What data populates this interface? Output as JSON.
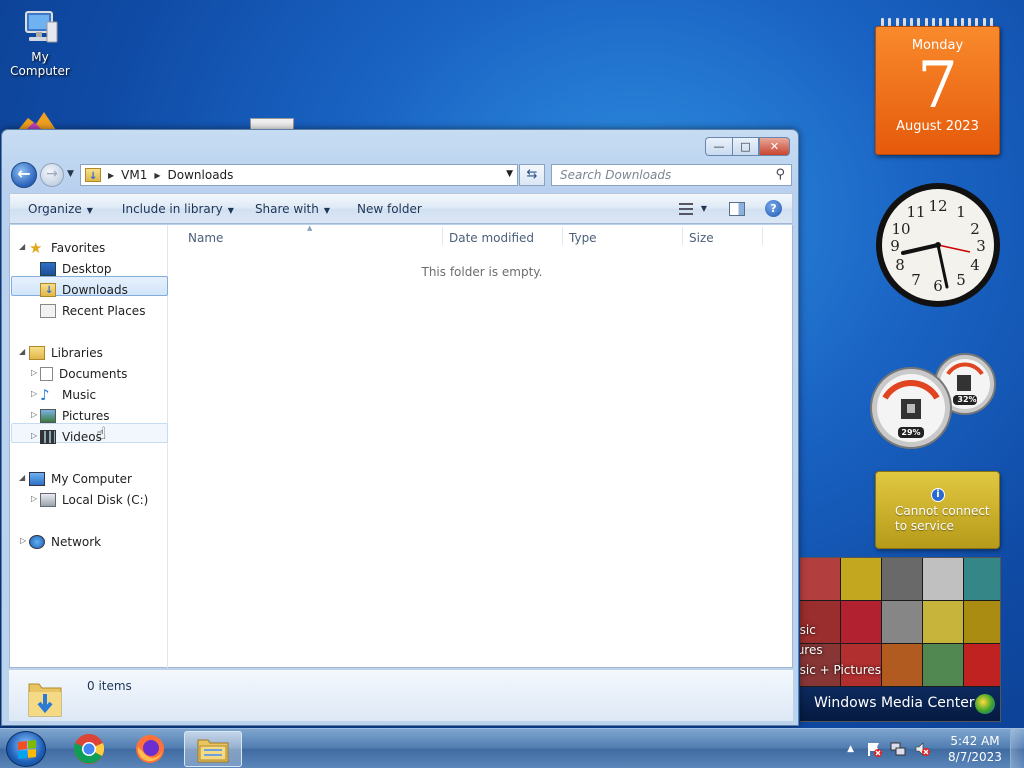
{
  "desktop": {
    "icons": [
      {
        "label": "My Computer"
      }
    ]
  },
  "gadgets": {
    "calendar": {
      "weekday": "Monday",
      "day": "7",
      "month_year": "August 2023"
    },
    "meter": {
      "cpu_percent": "29%",
      "memory_percent": "32%"
    },
    "weather": {
      "message_line1": "Cannot connect",
      "message_line2": "to service"
    },
    "media_center": {
      "menu_items": [
        "usic",
        "tures",
        "usic + Pictures"
      ],
      "title": "Windows Media Center"
    }
  },
  "window": {
    "controls": {
      "minimize": "—",
      "maximize": "□",
      "close": "✕"
    },
    "breadcrumb": [
      "VM1",
      "Downloads"
    ],
    "search_placeholder": "Search Downloads",
    "toolbar": {
      "organize": "Organize",
      "include_in_library": "Include in library",
      "share_with": "Share with",
      "new_folder": "New folder"
    },
    "nav": {
      "favorites": "Favorites",
      "desktop": "Desktop",
      "downloads": "Downloads",
      "recent_places": "Recent Places",
      "libraries": "Libraries",
      "documents": "Documents",
      "music": "Music",
      "pictures": "Pictures",
      "videos": "Videos",
      "my_computer": "My Computer",
      "local_disk": "Local Disk (C:)",
      "network": "Network"
    },
    "columns": [
      "Name",
      "Date modified",
      "Type",
      "Size"
    ],
    "empty_message": "This folder is empty.",
    "item_count": "0 items"
  },
  "taskbar": {
    "apps": [
      "chrome-icon",
      "firefox-icon",
      "windows-explorer-icon"
    ],
    "time": "5:42 AM",
    "date": "8/7/2023"
  },
  "colors": {
    "desktop_bg": "#1a64c4",
    "calendar_orange": "#e55a0b",
    "weather_yellow": "#cdb231",
    "selection_blue": "#d2e5fa"
  }
}
